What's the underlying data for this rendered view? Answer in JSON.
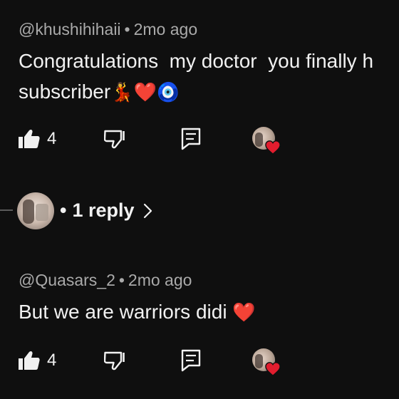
{
  "comments": [
    {
      "author": "@khushihihaii",
      "separator": "•",
      "time": "2mo ago",
      "text_line1": "Congratulations  my doctor  you finally h",
      "text_line2": "subscriber",
      "emojis": [
        "💃",
        "❤️",
        "🧿"
      ],
      "like_count": "4",
      "replies": {
        "separator": "•",
        "label": "1 reply"
      }
    },
    {
      "author": "@Quasars_2",
      "separator": "•",
      "time": "2mo ago",
      "text_line1": "But we are warriors didi",
      "emojis": [
        "❤️"
      ],
      "like_count": "4"
    }
  ],
  "icons": {
    "like": "thumbs-up-icon",
    "dislike": "thumbs-down-icon",
    "reply": "comment-reply-icon",
    "creator_heart": "creator-heart-avatar-icon",
    "chevron": "chevron-right-icon"
  },
  "colors": {
    "background": "#0f0f0f",
    "text": "#f1f1f1",
    "meta": "#aaaaaa",
    "heart": "#e11d2e"
  }
}
